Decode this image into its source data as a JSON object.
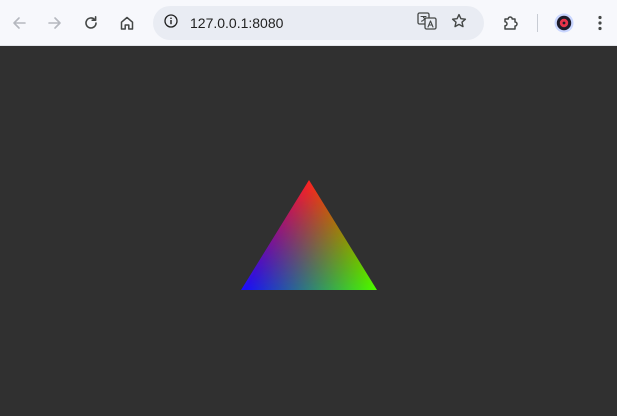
{
  "browser": {
    "address_bar": {
      "url": "127.0.0.1:8080"
    },
    "icons": {
      "back": "back-arrow-icon",
      "forward": "forward-arrow-icon",
      "reload": "reload-icon",
      "home": "home-icon",
      "site_info": "info-icon",
      "translate": "translate-icon",
      "bookmark": "star-icon",
      "extensions": "puzzle-icon",
      "profile": "avatar",
      "menu": "kebab-menu-icon"
    }
  },
  "page": {
    "background_color": "#303030",
    "triangle": {
      "vertex_colors": {
        "top": "#ff1a1a",
        "bottom_left": "#1a10ff",
        "bottom_right": "#4cff00"
      }
    }
  }
}
